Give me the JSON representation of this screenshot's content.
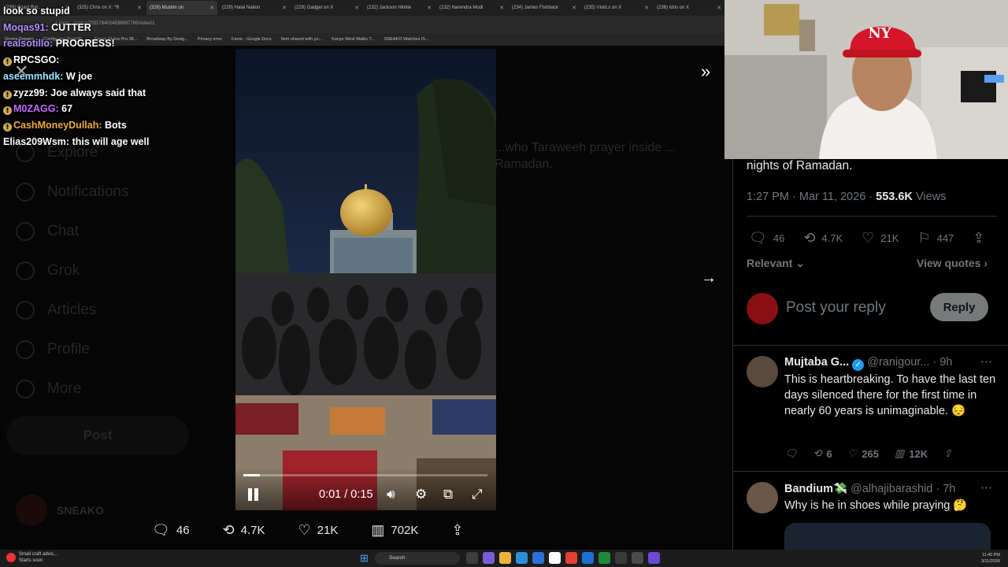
{
  "browser": {
    "tabs": [
      {
        "label": "(239) Coast Bat..."
      },
      {
        "label": "(325) Chris on X: \"R"
      },
      {
        "label": "(326) Muslim on"
      },
      {
        "label": "(229) Halal Nation"
      },
      {
        "label": "(229) Gadget on X"
      },
      {
        "label": "(232) Jackson Hinkle"
      },
      {
        "label": "(232) Narendra Modi"
      },
      {
        "label": "(234) James Fishback"
      },
      {
        "label": "(235) Vivid.s on X"
      },
      {
        "label": "(236) Idris on X"
      }
    ],
    "url": "x.com/.../status/2031784024838897765/video/1",
    "bookmarks": [
      "Gmma Repairs",
      "Configuring SonicW...",
      "Epson Stylus Pro 38...",
      "Broadway By Desig...",
      "Privacy error",
      "Fame - Google Docs",
      "Item shared with yo...",
      "Kanye West Walks T...",
      "SNEAKO Watches IS..."
    ]
  },
  "chat": [
    {
      "user": "",
      "msg": "look so stupid",
      "color": "#ffffff",
      "badge": false
    },
    {
      "user": "Moqas91:",
      "msg": "CUTTER",
      "color": "#b58cff",
      "badge": false
    },
    {
      "user": "realsotillo:",
      "msg": "PROGRESS!",
      "color": "#b58cff",
      "badge": false
    },
    {
      "user": "RPCSGO:",
      "msg": "",
      "color": "#ffffff",
      "badge": true
    },
    {
      "user": "aseemmhdk:",
      "msg": "W joe",
      "color": "#9ae6ff",
      "badge": false
    },
    {
      "user": "zyzz99:",
      "msg": "Joe always said that",
      "color": "#ffffff",
      "badge": true
    },
    {
      "user": "M0ZAGG:",
      "msg": "67",
      "color": "#c76bff",
      "badge": true
    },
    {
      "user": "CashMoneyDullah:",
      "msg": "Bots",
      "color": "#f2a93b",
      "badge": true
    },
    {
      "user": "Elias209Wsm:",
      "msg": "this will age well",
      "color": "#ffffff",
      "badge": false
    }
  ],
  "sidebar_bg": [
    "Explore",
    "Notifications",
    "Chat",
    "Grok",
    "Articles",
    "Profile",
    "More"
  ],
  "sidebar_post": "Post",
  "bg_tweet": "...who Taraweeh prayer inside ... Ramadan.",
  "bg_profile": "SNEAKO",
  "video": {
    "time": "0:01 / 0:15",
    "progress": 0.067
  },
  "actions": {
    "replies": "46",
    "reposts": "4.7K",
    "likes": "21K",
    "views": "702K"
  },
  "panel": {
    "tweet_tail": "nights of Ramadan.",
    "timestamp": "1:27 PM · Mar 11, 2026 ·",
    "views_count": "553.6K",
    "views_label": "Views",
    "stats": {
      "replies": "46",
      "reposts": "4.7K",
      "likes": "21K",
      "bookmarks": "447"
    },
    "sort": "Relevant",
    "view_quotes": "View quotes",
    "reply_placeholder": "Post your reply",
    "reply_button": "Reply",
    "replies": [
      {
        "name": "Mujtaba G...",
        "handle": "@ranigour...",
        "time": "· 9h",
        "text": "This is heartbreaking. To have the last ten days silenced there for the first time in nearly 60 years is unimaginable. 😔",
        "reposts": "6",
        "likes": "265",
        "views": "12K"
      },
      {
        "name": "Bandium💸",
        "handle": "@alhajibarashid",
        "time": "· 7h",
        "text": "Why is he in shoes while praying 🤔"
      }
    ]
  },
  "taskbar": {
    "weather_title": "Small craft advis...",
    "weather_sub": "Starts soon",
    "search": "Search",
    "time": "11:40 PM",
    "date": "3/11/2026"
  },
  "colors": {
    "accent": "#1d9bf0",
    "muted": "#71767b",
    "border": "#2f3336"
  }
}
